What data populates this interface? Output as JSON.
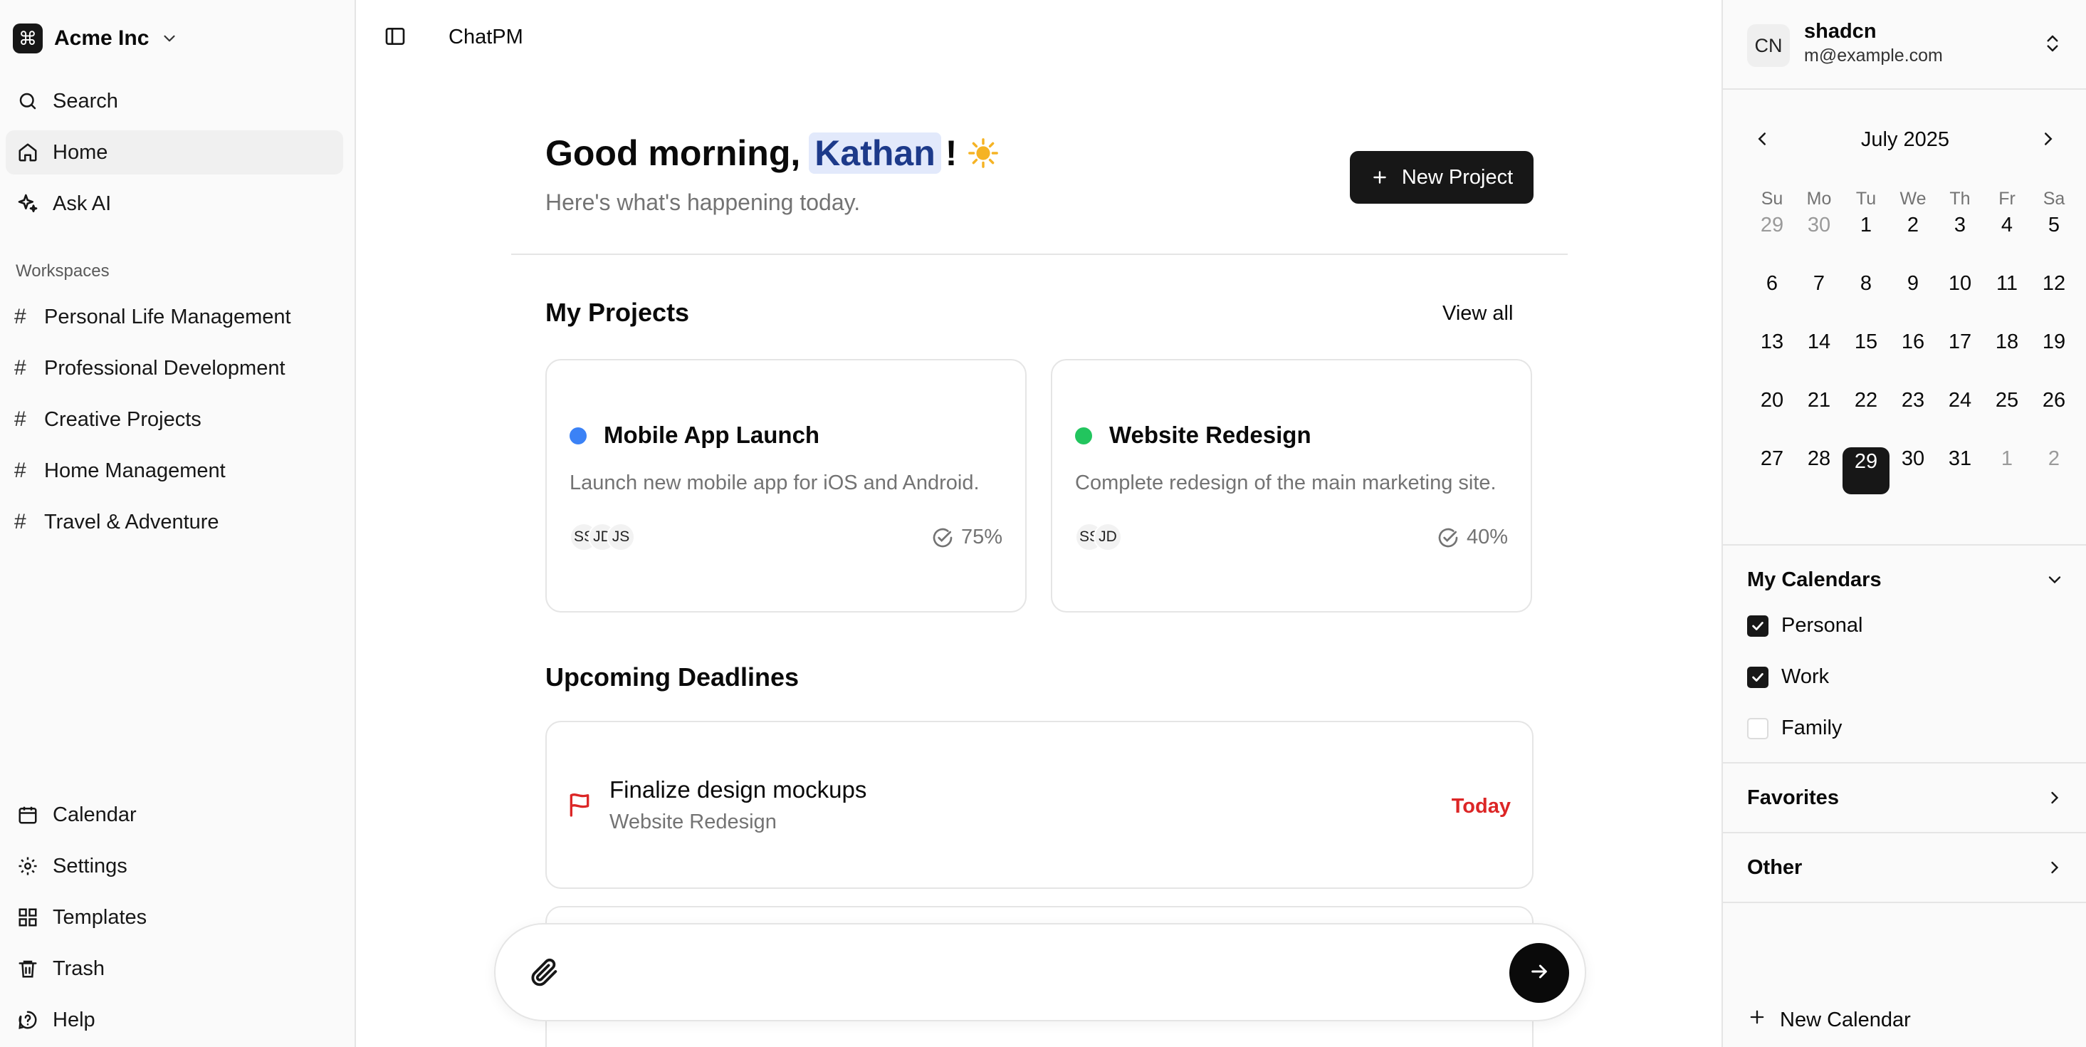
{
  "sidebar": {
    "org_name": "Acme Inc",
    "nav": [
      {
        "label": "Search",
        "icon": "search-icon"
      },
      {
        "label": "Home",
        "icon": "home-icon",
        "active": true
      },
      {
        "label": "Ask AI",
        "icon": "sparkles-icon"
      }
    ],
    "workspaces_label": "Workspaces",
    "workspaces": [
      "Personal Life Management",
      "Professional Development",
      "Creative Projects",
      "Home Management",
      "Travel & Adventure"
    ],
    "footer": [
      {
        "label": "Calendar",
        "icon": "calendar-icon"
      },
      {
        "label": "Settings",
        "icon": "gear-icon"
      },
      {
        "label": "Templates",
        "icon": "templates-icon"
      },
      {
        "label": "Trash",
        "icon": "trash-icon"
      },
      {
        "label": "Help",
        "icon": "help-icon"
      }
    ]
  },
  "header": {
    "app_title": "ChatPM"
  },
  "main": {
    "greeting_prefix": "Good morning,",
    "greeting_name": "Kathan",
    "greeting_suffix": "!",
    "subtitle": "Here's what's happening today.",
    "new_project_label": "New Project",
    "projects_title": "My Projects",
    "view_all_label": "View all",
    "projects": [
      {
        "title": "Mobile App Launch",
        "description": "Launch new mobile app for iOS and Android.",
        "members": [
          "SS",
          "JD",
          "JS"
        ],
        "progress": "75%",
        "dot_color": "#3b82f6"
      },
      {
        "title": "Website Redesign",
        "description": "Complete redesign of the main marketing site.",
        "members": [
          "SS",
          "JD"
        ],
        "progress": "40%",
        "dot_color": "#22c55e"
      }
    ],
    "deadlines_title": "Upcoming Deadlines",
    "deadlines": [
      {
        "title": "Finalize design mockups",
        "project": "Website Redesign",
        "when": "Today",
        "when_color": "#dc2626"
      }
    ],
    "composer_placeholder": ""
  },
  "right": {
    "user_initials": "CN",
    "user_name": "shadcn",
    "user_email": "m@example.com",
    "calendar": {
      "month": "July 2025",
      "weekdays": [
        "Su",
        "Mo",
        "Tu",
        "We",
        "Th",
        "Fr",
        "Sa"
      ],
      "days": [
        {
          "n": "29",
          "muted": true
        },
        {
          "n": "30",
          "muted": true
        },
        {
          "n": "1"
        },
        {
          "n": "2"
        },
        {
          "n": "3"
        },
        {
          "n": "4"
        },
        {
          "n": "5"
        },
        {
          "n": "6"
        },
        {
          "n": "7"
        },
        {
          "n": "8"
        },
        {
          "n": "9"
        },
        {
          "n": "10"
        },
        {
          "n": "11"
        },
        {
          "n": "12"
        },
        {
          "n": "13"
        },
        {
          "n": "14"
        },
        {
          "n": "15"
        },
        {
          "n": "16"
        },
        {
          "n": "17"
        },
        {
          "n": "18"
        },
        {
          "n": "19"
        },
        {
          "n": "20"
        },
        {
          "n": "21"
        },
        {
          "n": "22"
        },
        {
          "n": "23"
        },
        {
          "n": "24"
        },
        {
          "n": "25"
        },
        {
          "n": "26"
        },
        {
          "n": "27"
        },
        {
          "n": "28"
        },
        {
          "n": "29",
          "selected": true
        },
        {
          "n": "30"
        },
        {
          "n": "31"
        },
        {
          "n": "1",
          "muted": true
        },
        {
          "n": "2",
          "muted": true
        }
      ]
    },
    "my_calendars_label": "My Calendars",
    "calendars": [
      {
        "label": "Personal",
        "checked": true
      },
      {
        "label": "Work",
        "checked": true
      },
      {
        "label": "Family",
        "checked": false
      }
    ],
    "favorites_label": "Favorites",
    "other_label": "Other",
    "new_calendar_label": "New Calendar"
  }
}
